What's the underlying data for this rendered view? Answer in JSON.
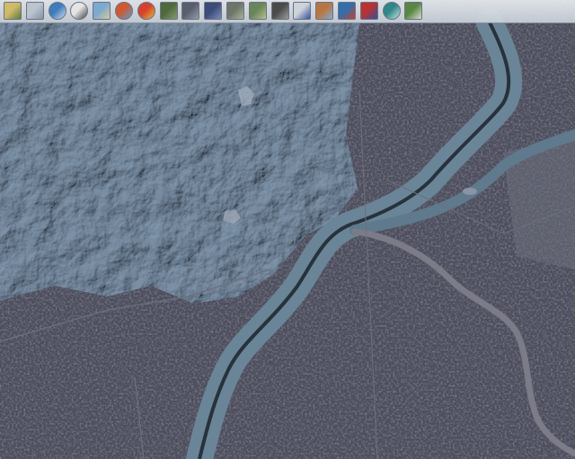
{
  "map": {
    "view": "satellite-imagery"
  },
  "toolbar": {
    "tools": [
      {
        "name": "layer-select-icon",
        "colors": [
          "#d9c36a",
          "#5d7d3a"
        ]
      },
      {
        "name": "grid-icon",
        "colors": [
          "#c4ccd8",
          "#8a97aa"
        ]
      },
      {
        "name": "globe-icon",
        "colors": [
          "#3d7fc4",
          "#d8e8f4"
        ]
      },
      {
        "name": "zoom-magnifier-icon",
        "colors": [
          "#f0f0f0",
          "#404040"
        ]
      },
      {
        "name": "landsat-icon",
        "colors": [
          "#7fb0d8",
          "#e4d2a0"
        ]
      },
      {
        "name": "elevation-map-icon",
        "colors": [
          "#d85a2e",
          "#5aa3d8"
        ]
      },
      {
        "name": "thermal-map-icon",
        "colors": [
          "#e0402a",
          "#f0c030"
        ]
      },
      {
        "name": "imagery-thumb-1-icon",
        "colors": [
          "#4f6b3a",
          "#8aa070"
        ]
      },
      {
        "name": "imagery-thumb-2-icon",
        "colors": [
          "#5a5f70",
          "#9aa0b0"
        ]
      },
      {
        "name": "imagery-thumb-3-icon",
        "colors": [
          "#3a4a78",
          "#8090c0"
        ]
      },
      {
        "name": "imagery-thumb-4-icon",
        "colors": [
          "#707868",
          "#b0b8a0"
        ]
      },
      {
        "name": "imagery-thumb-5-icon",
        "colors": [
          "#6a8a58",
          "#c0c890"
        ]
      },
      {
        "name": "imagery-thumb-6-icon",
        "colors": [
          "#4a4a4a",
          "#a0a0a0"
        ]
      },
      {
        "name": "draw-line-icon",
        "colors": [
          "#d8dce4",
          "#3050a0"
        ]
      },
      {
        "name": "measure-icon",
        "colors": [
          "#c07840",
          "#8ab0d0"
        ]
      },
      {
        "name": "overlay-toggle-icon",
        "colors": [
          "#3070b0",
          "#d04030"
        ]
      },
      {
        "name": "flag-map-icon",
        "colors": [
          "#c03030",
          "#3050a0"
        ]
      },
      {
        "name": "world-globe-icon",
        "colors": [
          "#2e8a8a",
          "#d0f0f0"
        ]
      },
      {
        "name": "usa-map-icon",
        "colors": [
          "#5a8a40",
          "#e0e8d8"
        ]
      }
    ]
  }
}
